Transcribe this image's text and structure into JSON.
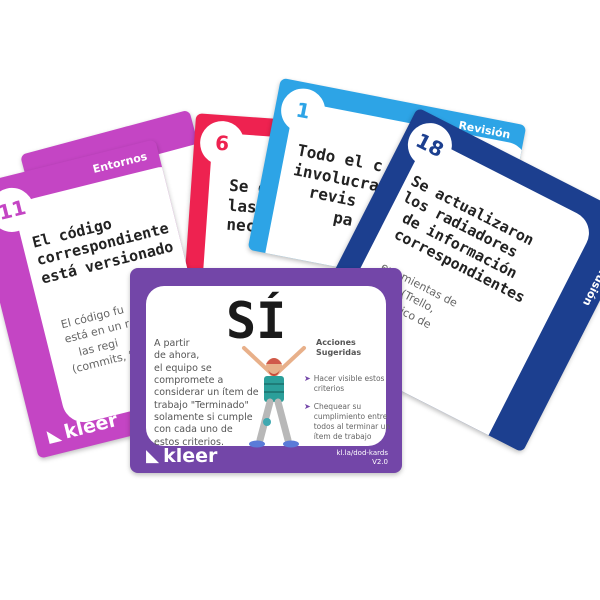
{
  "cards": {
    "purple": {
      "number": "11",
      "category": "Entornos",
      "title": "El código\ncorrespondiente\nestá versionado",
      "body": "El código fu\nestá en un r\n   las regi\n(commits, t",
      "logo": "kleer",
      "color": "#c445c4"
    },
    "red": {
      "number": "6",
      "title": "Se ejec\nlas pr\nnece",
      "color": "#ee2250"
    },
    "lightblue": {
      "number": "1",
      "category": "Revisión",
      "title": "Todo el c\ninvolucra\n  revis\n     pa",
      "color": "#2da4e6"
    },
    "navy": {
      "number": "18",
      "category": "Difusión",
      "title": "Se actualizaron\nlos radiadores\n de información\n correspondientes",
      "body": "erramientas de\nadas (Trello,\n       físico de",
      "color": "#1c3f8f"
    },
    "front": {
      "title": "SÍ",
      "description": "A partir\nde ahora,\nel equipo se\ncomprometе a\nconsiderar un ítem de\ntrabajo \"Terminado\"\nsolamente si cumple\ncon cada uno de\nestos criterios.",
      "actions_title": "Acciones\nSugeridas",
      "actions": [
        "Hacer visible estos\ncriterios",
        "Chequear su\ncumplimiento entre\ntodos al terminar un\nítem de trabajo"
      ],
      "logo": "kleer",
      "url": "kl.la/dod-kards",
      "version": "V2.0",
      "color": "#7346a8"
    }
  }
}
